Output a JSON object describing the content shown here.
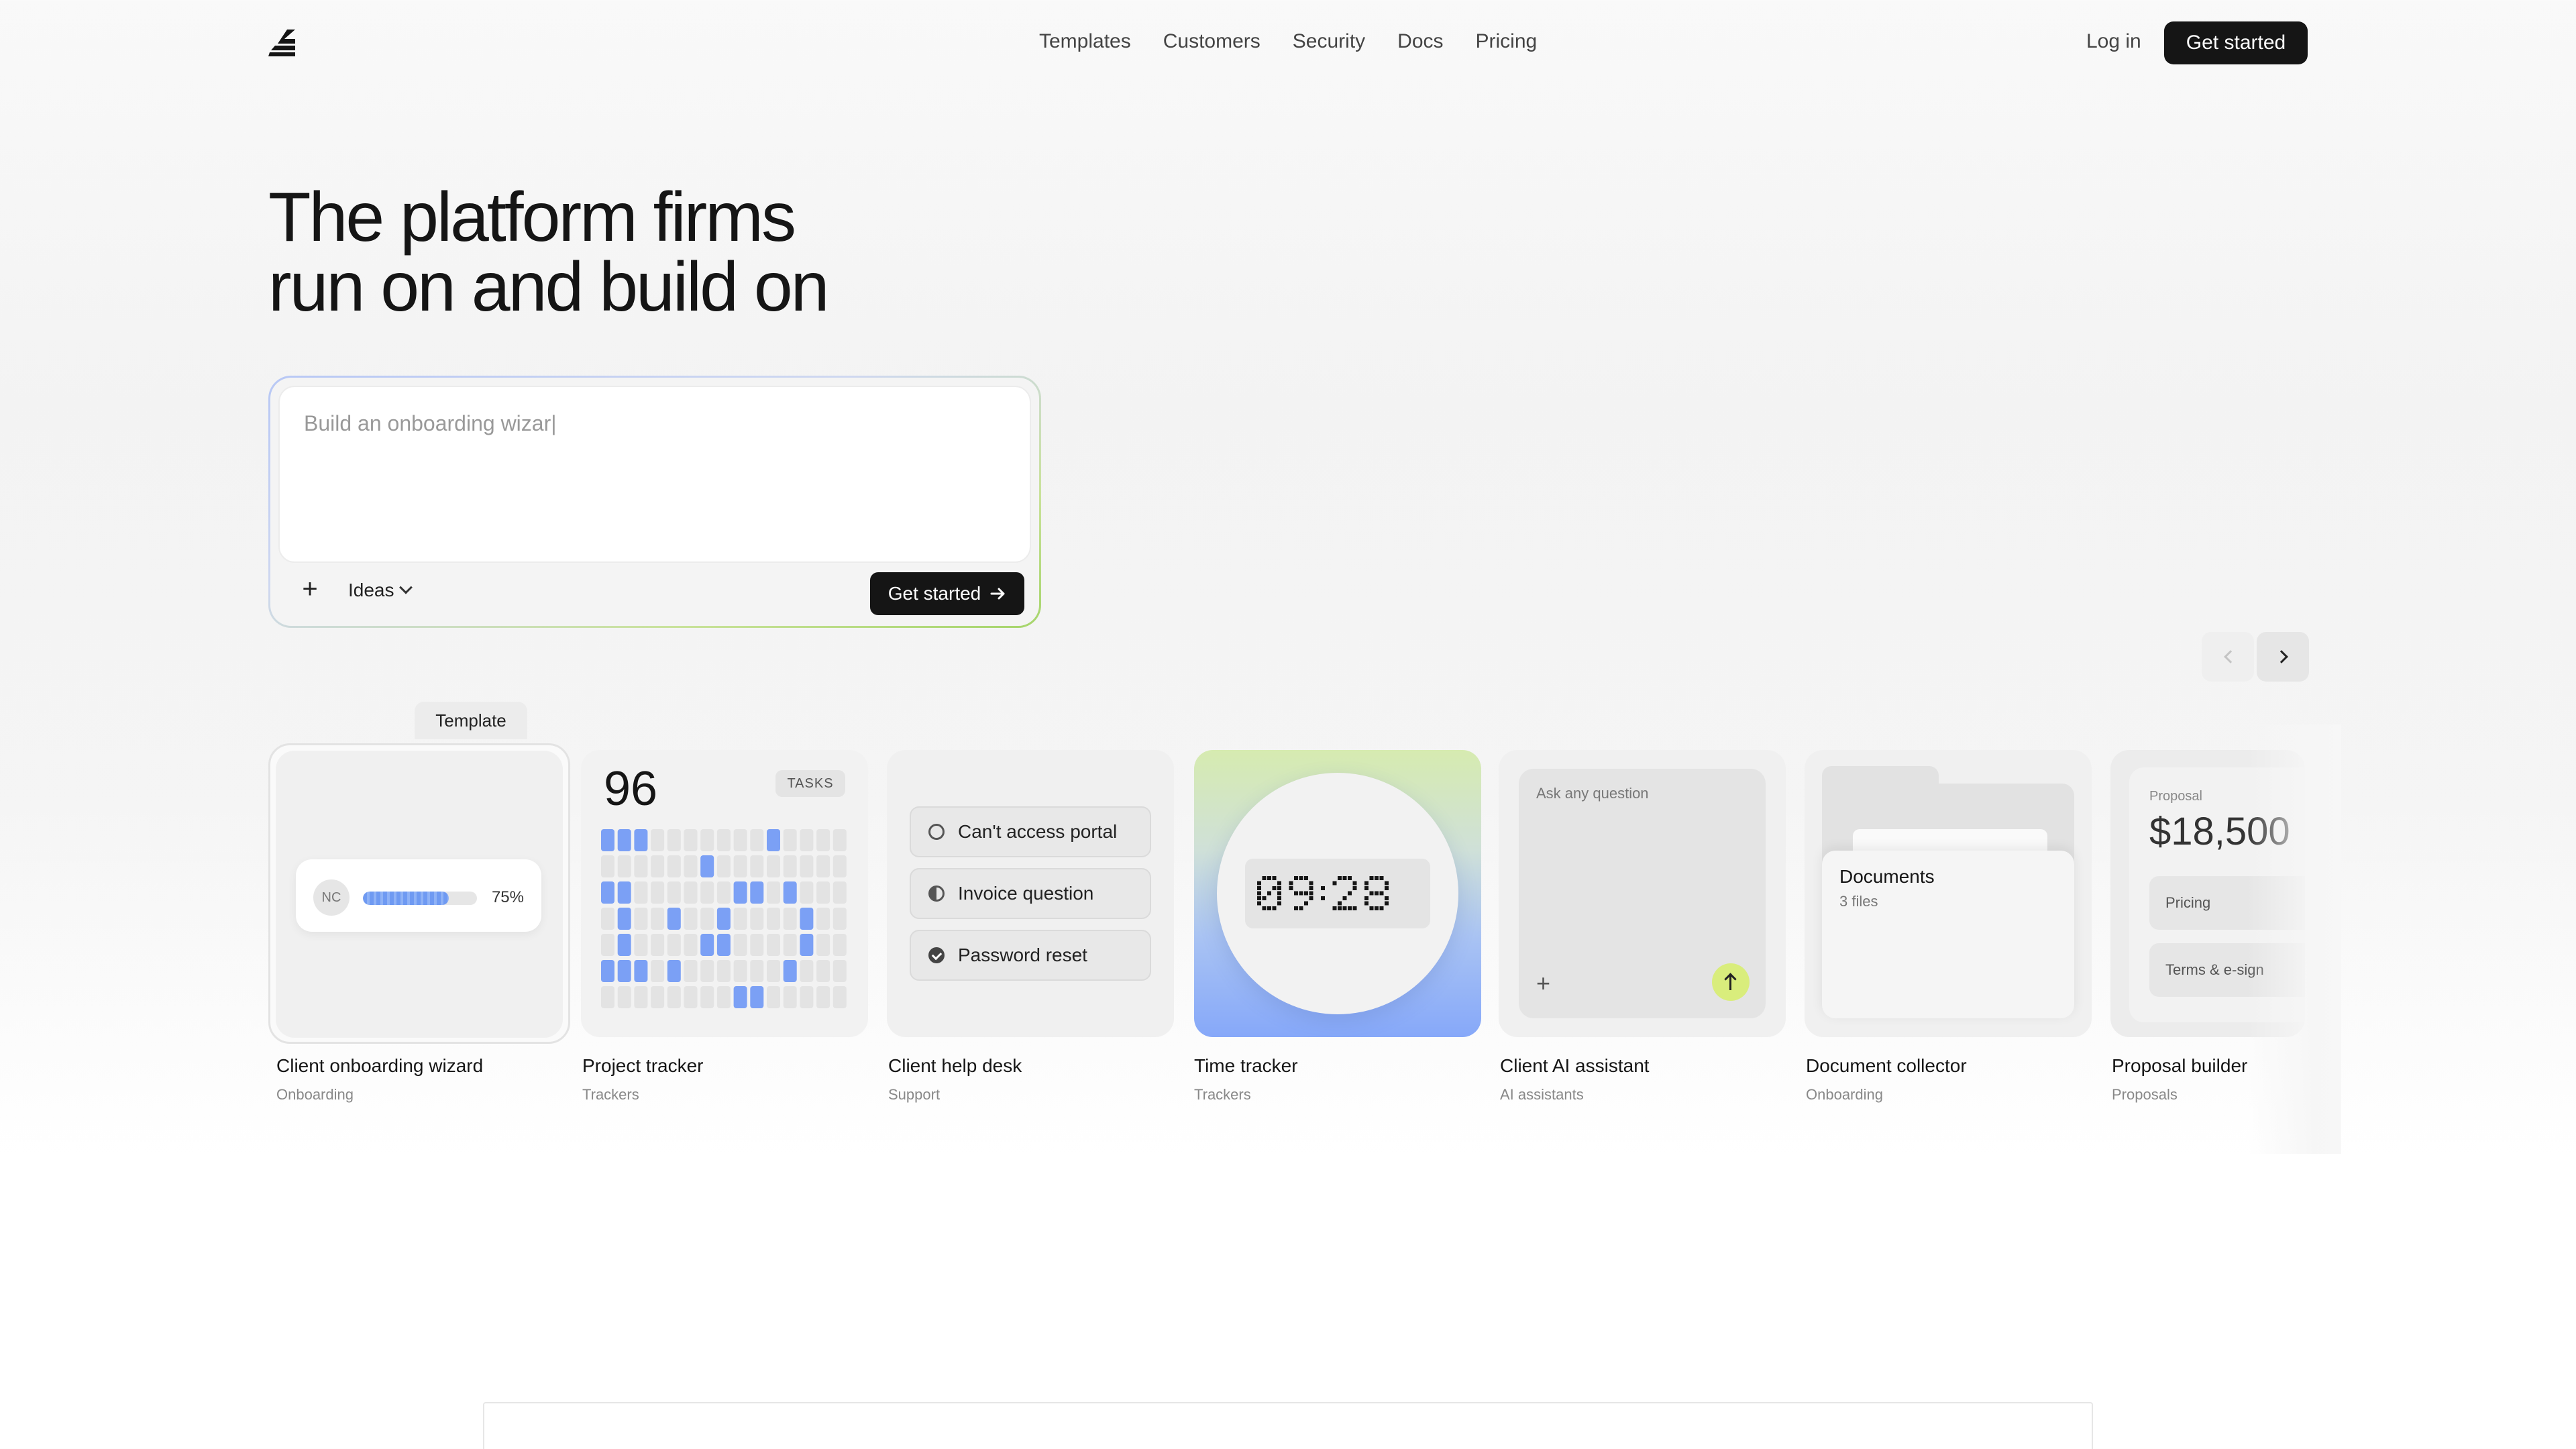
{
  "nav": {
    "links": [
      "Templates",
      "Customers",
      "Security",
      "Docs",
      "Pricing"
    ],
    "login": "Log in",
    "cta": "Get started"
  },
  "hero": {
    "title_line1": "The platform firms",
    "title_line2": "run on and build on"
  },
  "prompt": {
    "text": "Build an onboarding wizar|",
    "add_icon": "+",
    "ideas_label": "Ideas",
    "cta": "Get started",
    "gradient_colors": [
      "#b8c8f5",
      "#a6d56b"
    ]
  },
  "template_tag": "Template",
  "templates": [
    {
      "title": "Client onboarding wizard",
      "category": "Onboarding",
      "preview": {
        "avatar": "NC",
        "progress": 0.75,
        "progress_label": "75%"
      }
    },
    {
      "title": "Project tracker",
      "category": "Trackers",
      "preview": {
        "count": "96",
        "badge": "TASKS"
      }
    },
    {
      "title": "Client help desk",
      "category": "Support",
      "preview": {
        "items": [
          "Can't access portal",
          "Invoice question",
          "Password reset"
        ]
      }
    },
    {
      "title": "Time tracker",
      "category": "Trackers",
      "preview": {
        "time": "09:28"
      }
    },
    {
      "title": "Client AI assistant",
      "category": "AI assistants",
      "preview": {
        "placeholder": "Ask any question",
        "add_icon": "+",
        "accent": "#d9ed7c"
      }
    },
    {
      "title": "Document collector",
      "category": "Onboarding",
      "preview": {
        "folder_name": "Documents",
        "files": "3 files"
      }
    },
    {
      "title": "Proposal builder",
      "category": "Proposals",
      "preview": {
        "label": "Proposal",
        "amount": "$18,500",
        "rows": [
          "Pricing",
          "Terms & e-sign"
        ]
      }
    }
  ],
  "colors": {
    "cta_bg": "#151515",
    "tracker_blue": "#7ba0f5",
    "timer_gradient": [
      "#d6ebb0",
      "#86a8f9"
    ]
  }
}
